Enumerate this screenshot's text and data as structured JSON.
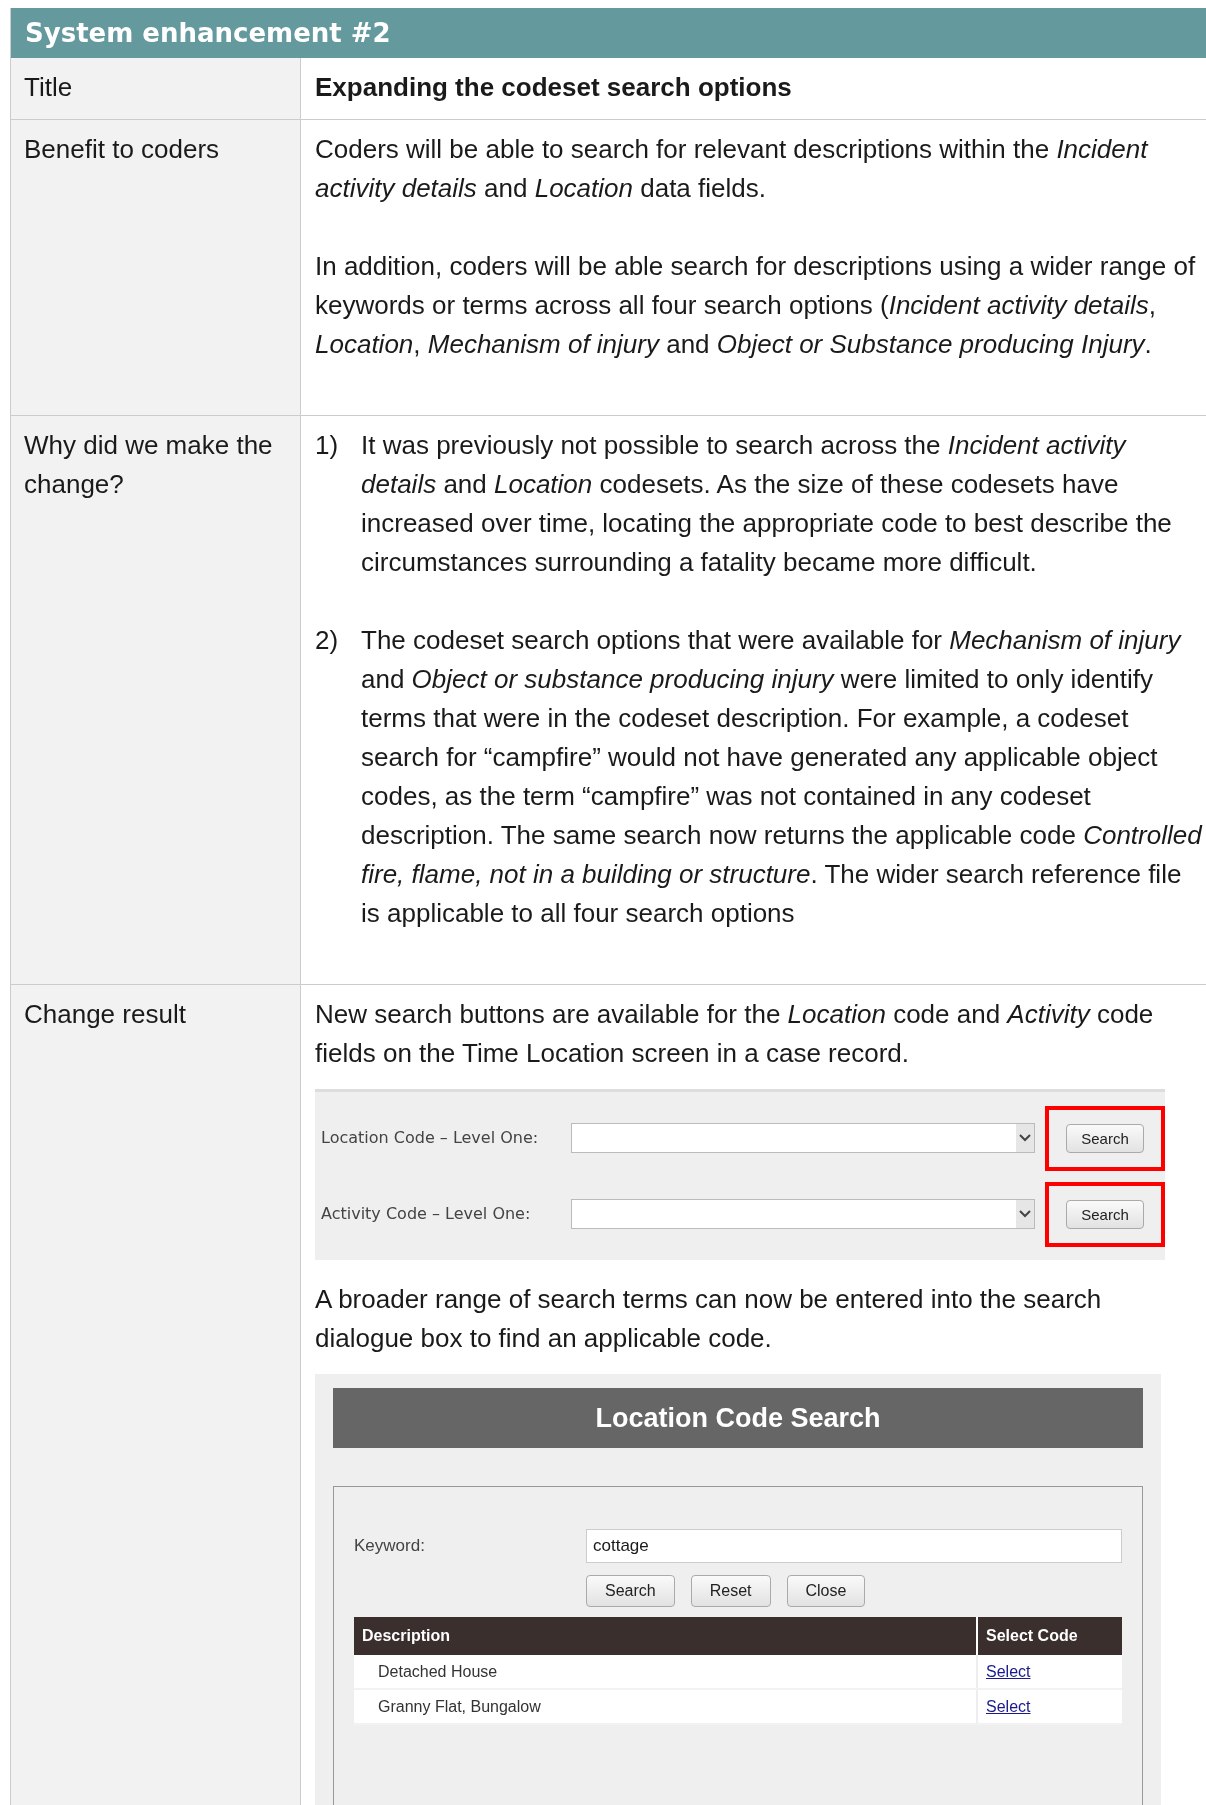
{
  "header": {
    "title": "System enhancement #2"
  },
  "rows": [
    {
      "label": "Title",
      "kind": "title",
      "text": "Expanding the codeset search options"
    },
    {
      "label": "Benefit to coders",
      "kind": "paragraphs",
      "paragraphs": [
        "Coders will be able to search for relevant descriptions within the *Incident activity details* and *Location* data fields.",
        "In addition, coders will be able search for descriptions using a wider range of keywords or terms across all four search options (*Incident activity details*, *Location*, *Mechanism of injury* and *Object or Substance producing Injury*."
      ]
    },
    {
      "label": "Why did we make the change?",
      "kind": "numbered",
      "items": [
        {
          "number": "1)",
          "text": "It was previously not possible to search across the *Incident activity details* and *Location* codesets. As the size of these codesets have increased over time, locating the appropriate code to best describe the circumstances surrounding a fatality became more difficult."
        },
        {
          "number": "2)",
          "text": "The codeset search options that were available for *Mechanism of injury* and *Object or substance producing injury* were limited to only identify terms that were in the codeset description. For example, a codeset search for “campfire” would not have generated any applicable object codes, as the term “campfire” was not contained in any codeset description. The same search now returns the applicable code *Controlled fire, flame, not in a building or structure*. The wider search reference file is applicable to all four search options"
        }
      ]
    },
    {
      "label": "Change result",
      "kind": "result",
      "intro": "New search buttons are available for the *Location* code and *Activity* code fields on the Time Location screen in a case record.",
      "form": [
        {
          "label": "Location Code – Level One:",
          "button": "Search",
          "highlighted": true
        },
        {
          "label": "Activity Code – Level One:",
          "button": "Search",
          "highlighted": true
        }
      ],
      "after": "A broader range of search terms can now be entered into the search dialogue box to find an applicable code.",
      "dialog": {
        "title": "Location Code Search",
        "keyword_label": "Keyword:",
        "keyword_value": "cottage",
        "buttons": [
          "Search",
          "Reset",
          "Close"
        ],
        "columns": [
          "Description",
          "Select Code"
        ],
        "results": [
          {
            "description": "Detached House",
            "link": "Select"
          },
          {
            "description": "Granny Flat, Bungalow",
            "link": "Select"
          }
        ]
      }
    }
  ]
}
